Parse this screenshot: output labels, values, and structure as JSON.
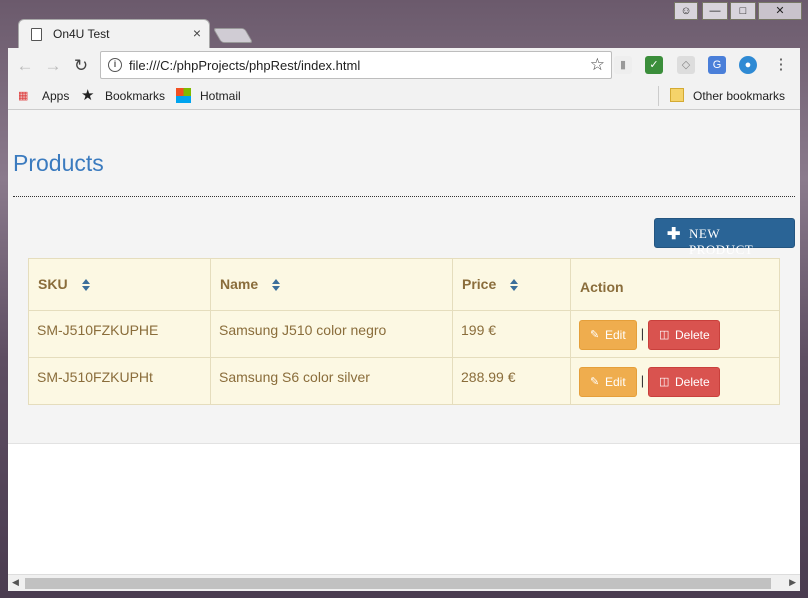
{
  "browser": {
    "tab_title": "On4U Test",
    "tab_close": "×",
    "url": "file:///C:/phpProjects/phpRest/index.html",
    "bookmarks": {
      "apps": "Apps",
      "bookmarks": "Bookmarks",
      "hotmail": "Hotmail",
      "other": "Other bookmarks"
    }
  },
  "page": {
    "title": "Products",
    "new_button": "NEW PRODUCT",
    "table": {
      "headers": [
        "SKU",
        "Name",
        "Price",
        "Action"
      ],
      "rows": [
        {
          "sku": "SM-J510FZKUPHE",
          "name": "Samsung J510 color negro",
          "price": "199 €",
          "edit": "Edit",
          "delete": "Delete"
        },
        {
          "sku": "SM-J510FZKUPHt",
          "name": "Samsung S6 color silver",
          "price": "288.99 €",
          "edit": "Edit",
          "delete": "Delete"
        }
      ],
      "separator": "|"
    }
  },
  "colors": {
    "title": "#3b7bbf",
    "primary_button": "#2a6496",
    "edit_button": "#efad4e",
    "delete_button": "#d9534f",
    "table_bg": "#fcf8e3",
    "table_text": "#8a6d3b"
  }
}
